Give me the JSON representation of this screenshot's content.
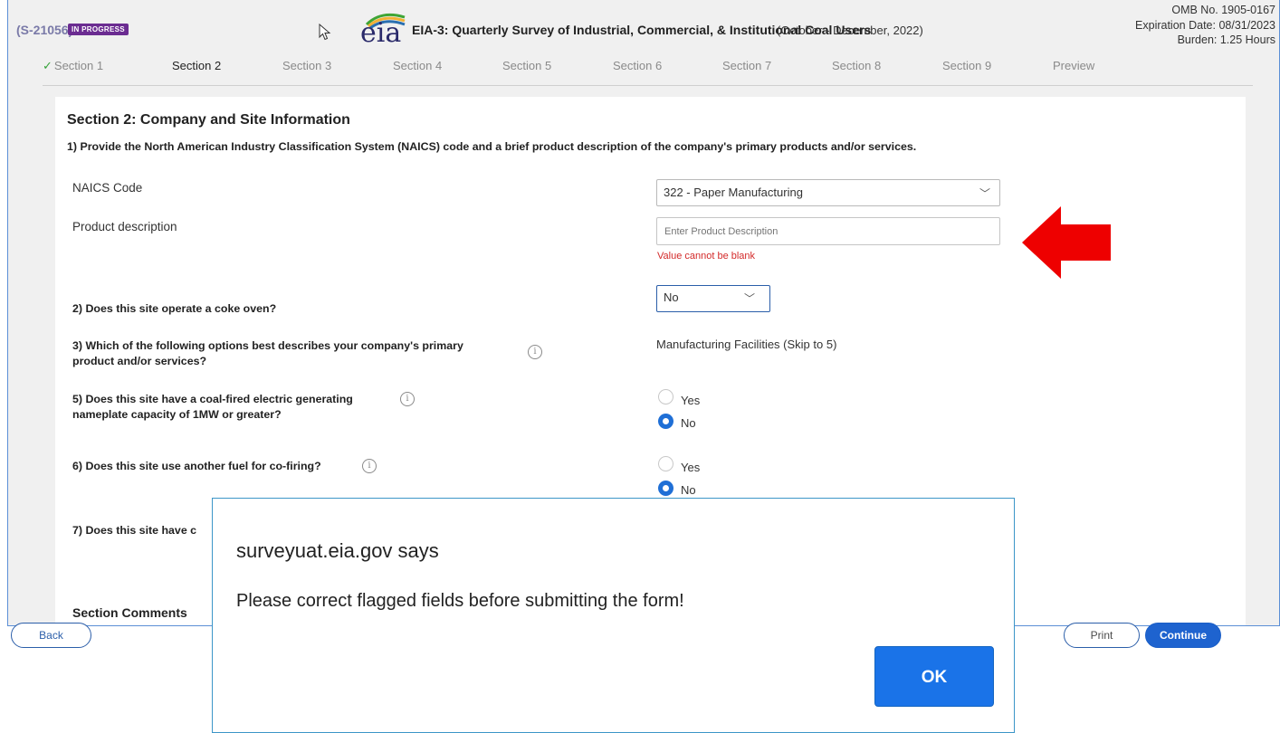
{
  "header": {
    "case_id": "(S-21056)",
    "status": "IN PROGRESS",
    "logo_text": "eia",
    "title": "EIA-3: Quarterly Survey of Industrial, Commercial, & Institutional Coal Users",
    "period": "(October - December, 2022)",
    "omb_number": "OMB No. 1905-0167",
    "expiration": "Expiration Date: 08/31/2023",
    "burden": "Burden: 1.25 Hours"
  },
  "tabs": [
    {
      "label": "Section 1",
      "state": "completed"
    },
    {
      "label": "Section 2",
      "state": "active"
    },
    {
      "label": "Section 3",
      "state": "inactive"
    },
    {
      "label": "Section 4",
      "state": "inactive"
    },
    {
      "label": "Section 5",
      "state": "inactive"
    },
    {
      "label": "Section 6",
      "state": "inactive"
    },
    {
      "label": "Section 7",
      "state": "inactive"
    },
    {
      "label": "Section 8",
      "state": "inactive"
    },
    {
      "label": "Section 9",
      "state": "inactive"
    },
    {
      "label": "Preview",
      "state": "inactive"
    }
  ],
  "section": {
    "heading": "Section 2: Company and Site Information",
    "q1": "1) Provide the North American Industry Classification System (NAICS) code and a brief product description of the company's primary products and/or services.",
    "naics_label": "NAICS Code",
    "naics_value": "322 - Paper Manufacturing",
    "product_label": "Product description",
    "product_placeholder": "Enter Product Description",
    "product_value": "",
    "product_error": "Value cannot be blank",
    "q2": "2) Does this site operate a coke oven?",
    "q2_value": "No",
    "q3_line1": "3) Which of the following options best describes your company's primary",
    "q3_line2": "product and/or services?",
    "q3_answer": "Manufacturing Facilities (Skip to 5)",
    "q5_line1": "5) Does this site have a coal-fired electric generating",
    "q5_line2": "nameplate capacity of 1MW or greater?",
    "q5_options": [
      {
        "label": "Yes",
        "selected": false
      },
      {
        "label": "No",
        "selected": true
      }
    ],
    "q6": "6) Does this site use another fuel for co-firing?",
    "q6_options": [
      {
        "label": "Yes",
        "selected": false
      },
      {
        "label": "No",
        "selected": true
      }
    ],
    "q7_partial": "7) Does this site have c",
    "section_comments_partial": "Section Comments"
  },
  "footer": {
    "back": "Back",
    "print": "Print",
    "continue": "Continue"
  },
  "dialog": {
    "title": "surveyuat.eia.gov says",
    "message": "Please correct flagged fields before submitting the form!",
    "ok": "OK"
  },
  "colors": {
    "accent_blue": "#1e63cf",
    "status_purple": "#6b2c91",
    "error_red": "#d32a2a",
    "arrow_red": "#ee0000",
    "check_green": "#36a33a"
  }
}
